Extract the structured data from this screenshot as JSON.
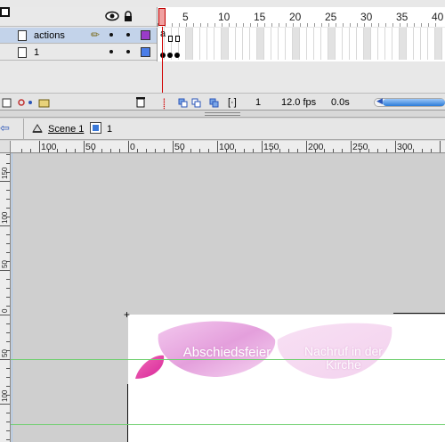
{
  "timeline": {
    "frame_numbers": [
      "1",
      "5",
      "10",
      "15",
      "20",
      "25",
      "30",
      "35",
      "40"
    ],
    "layers": [
      {
        "name": "actions",
        "selected": true,
        "color": "#9a3cc8"
      },
      {
        "name": "1",
        "selected": false,
        "color": "#4a7de8"
      }
    ],
    "footer": {
      "current_frame": "1",
      "fps": "12.0 fps",
      "elapsed": "0.0s"
    }
  },
  "edit_bar": {
    "scene_label": "Scene 1",
    "symbol_label": "1"
  },
  "rulers": {
    "horizontal_labels": [
      "100",
      "50",
      "0",
      "50",
      "100",
      "150",
      "200",
      "250",
      "300"
    ],
    "vertical_labels": [
      "150",
      "100",
      "50",
      "0",
      "50",
      "100"
    ]
  },
  "stage": {
    "buttons": [
      {
        "label": "Abschiedsfeier"
      },
      {
        "label": "Nachruf in der Kirche"
      }
    ]
  },
  "colors": {
    "petal_pink": "#e8a0dc",
    "guide_green": "#6fcf6f",
    "playhead_red": "#d10000"
  }
}
